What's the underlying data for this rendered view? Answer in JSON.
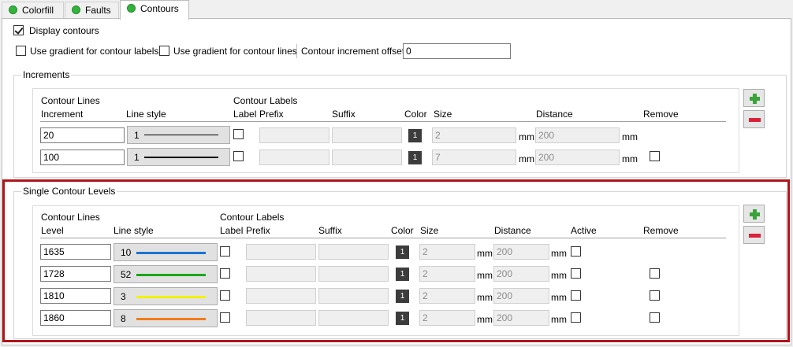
{
  "tabs": [
    {
      "label": "Colorfill"
    },
    {
      "label": "Faults"
    },
    {
      "label": "Contours"
    }
  ],
  "display_contours": {
    "label": "Display contours",
    "checked": true
  },
  "options": {
    "gradient_labels": "Use gradient for contour labels",
    "gradient_lines": "Use gradient for contour lines",
    "offset_label": "Contour increment offset",
    "offset_value": "0"
  },
  "increments": {
    "title": "Increments",
    "h_contour_lines": "Contour Lines",
    "h_contour_labels": "Contour Labels",
    "h_increment": "Increment",
    "h_line_style": "Line style",
    "h_label": "Label",
    "h_prefix": "Prefix",
    "h_suffix": "Suffix",
    "h_color": "Color",
    "h_size": "Size",
    "h_distance": "Distance",
    "h_remove": "Remove",
    "unit": "mm",
    "rows": [
      {
        "increment": "20",
        "style": "1",
        "color_num": "1",
        "size": "2",
        "distance": "200"
      },
      {
        "increment": "100",
        "style": "1",
        "color_num": "1",
        "size": "7",
        "distance": "200"
      }
    ]
  },
  "single": {
    "title": "Single Contour Levels",
    "h_contour_lines": "Contour Lines",
    "h_contour_labels": "Contour Labels",
    "h_level": "Level",
    "h_line_style": "Line style",
    "h_label": "Label",
    "h_prefix": "Prefix",
    "h_suffix": "Suffix",
    "h_color": "Color",
    "h_size": "Size",
    "h_distance": "Distance",
    "h_active": "Active",
    "h_remove": "Remove",
    "unit": "mm",
    "rows": [
      {
        "level": "1635",
        "style": "10",
        "line_color": "#1e73d2",
        "color_num": "1",
        "size": "2",
        "distance": "200"
      },
      {
        "level": "1728",
        "style": "52",
        "line_color": "#1aa61a",
        "color_num": "1",
        "size": "2",
        "distance": "200"
      },
      {
        "level": "1810",
        "style": "3",
        "line_color": "#f2f20a",
        "color_num": "1",
        "size": "2",
        "distance": "200"
      },
      {
        "level": "1860",
        "style": "8",
        "line_color": "#f07c1a",
        "color_num": "1",
        "size": "2",
        "distance": "200"
      }
    ]
  },
  "colors": {
    "highlight": "#b0151b",
    "add": "#3aa33a",
    "remove": "#d8233a"
  },
  "icons": {
    "add": "plus-icon",
    "remove": "minus-icon"
  }
}
